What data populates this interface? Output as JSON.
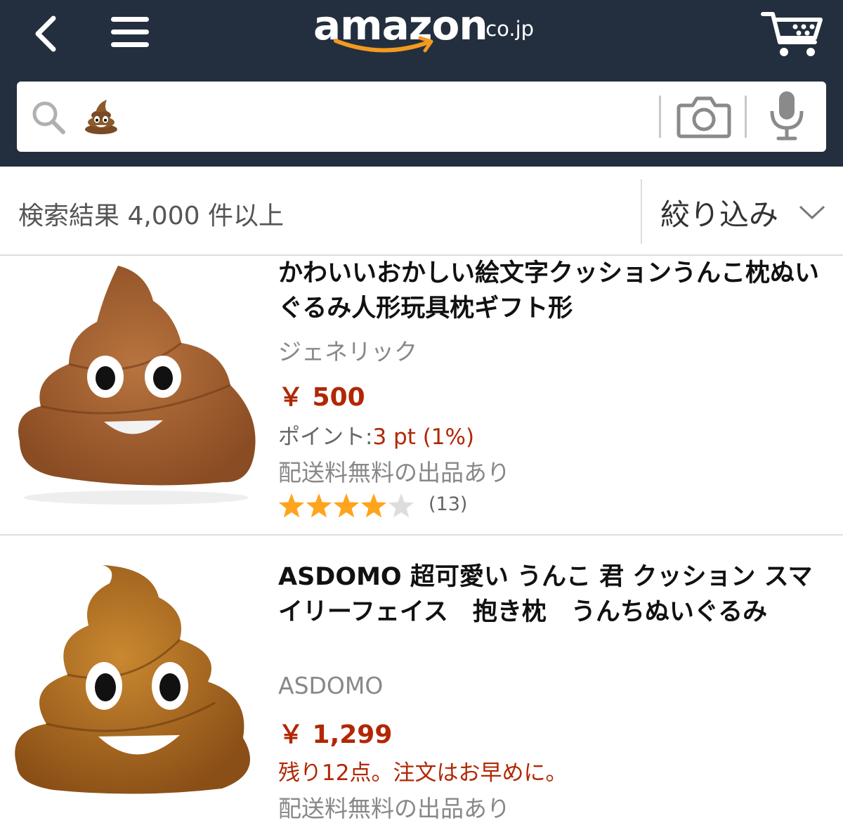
{
  "header": {
    "logo_main": "amazon",
    "logo_suffix": ".co.jp",
    "colors": {
      "bar": "#232f3e",
      "smile": "#f29a1f"
    }
  },
  "search": {
    "value": "💩"
  },
  "results": {
    "count_label": "検索結果 4,000 件以上",
    "filter_label": "絞り込み"
  },
  "products": [
    {
      "title": "かわいいおかしい絵文字クッションうんこ枕ぬいぐるみ人形玩具枕ギフト形",
      "brand": "ジェネリック",
      "price": "￥ 500",
      "points_label": "ポイント:",
      "points_value": "3 pt (1%)",
      "shipping": "配送料無料の出品あり",
      "rating": 4,
      "rating_max": 5,
      "reviews": "(13)"
    },
    {
      "title": "ASDOMO 超可愛い うんこ 君 クッション スマイリーフェイス　抱き枕　うんちぬいぐるみ",
      "brand": "ASDOMO",
      "price": "￥ 1,299",
      "stock": "残り12点。注文はお早めに。",
      "shipping": "配送料無料の出品あり"
    }
  ],
  "colors": {
    "price": "#b12704",
    "star_on": "#ffa41c",
    "star_off": "#dddddd"
  }
}
